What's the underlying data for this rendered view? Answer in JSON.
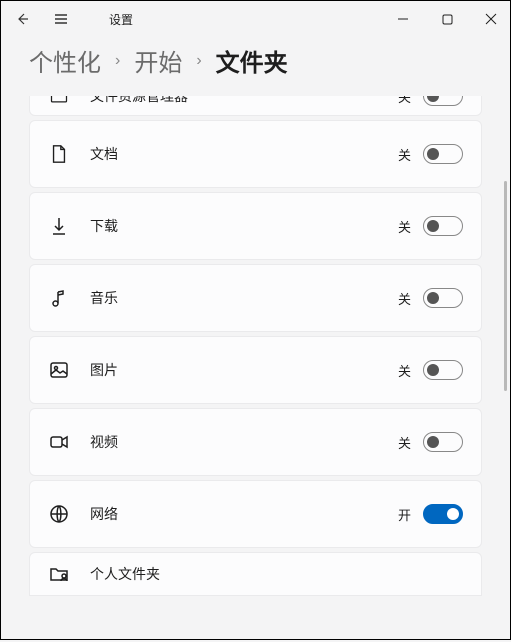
{
  "window": {
    "title": "设置"
  },
  "breadcrumb": {
    "level1": "个性化",
    "level2": "开始",
    "current": "文件夹"
  },
  "toggle_text": {
    "on": "开",
    "off": "关"
  },
  "rows": [
    {
      "icon": "file-explorer",
      "label": "文件资源管理器",
      "state": "关"
    },
    {
      "icon": "document",
      "label": "文档",
      "state": "关"
    },
    {
      "icon": "download",
      "label": "下载",
      "state": "关"
    },
    {
      "icon": "music",
      "label": "音乐",
      "state": "关"
    },
    {
      "icon": "picture",
      "label": "图片",
      "state": "关"
    },
    {
      "icon": "video",
      "label": "视频",
      "state": "关"
    },
    {
      "icon": "network",
      "label": "网络",
      "state": "开"
    },
    {
      "icon": "personal-folder",
      "label": "个人文件夹",
      "state": ""
    }
  ]
}
